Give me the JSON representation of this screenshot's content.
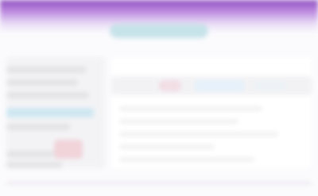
{
  "header": {
    "search_placeholder": ""
  },
  "sidebar": {
    "items": [
      "",
      "",
      "",
      "",
      "",
      "",
      ""
    ]
  },
  "main": {
    "lines": [
      "",
      "",
      "",
      "",
      ""
    ]
  },
  "colors": {
    "accent": "#8e4fbf",
    "highlight": "#cfe7f2",
    "badge": "#f0d4da"
  }
}
